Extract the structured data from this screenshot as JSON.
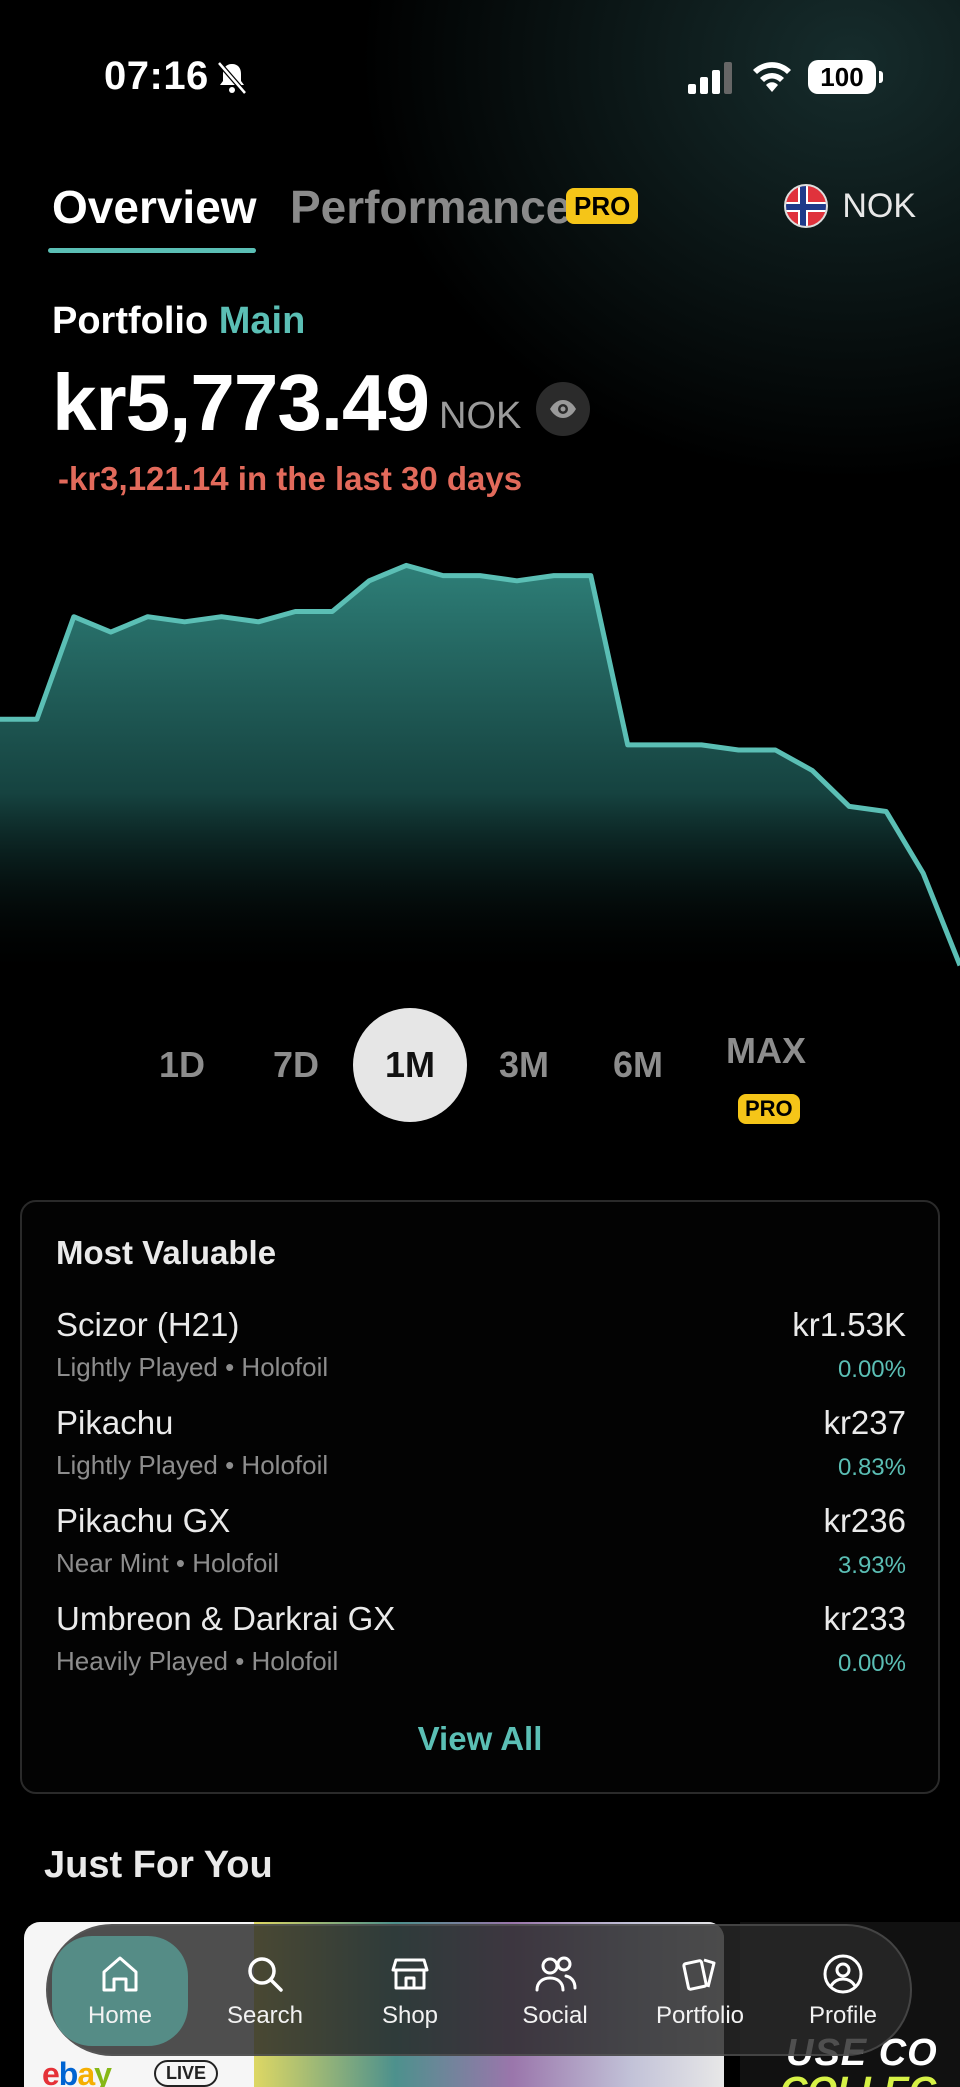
{
  "status_bar": {
    "time": "07:16",
    "battery": "100"
  },
  "tabs": {
    "overview": "Overview",
    "performance": "Performance",
    "performance_badge": "PRO",
    "currency": "NOK"
  },
  "portfolio": {
    "label": "Portfolio",
    "name": "Main",
    "value": "kr5,773.49",
    "value_currency": "NOK",
    "change_text": "-kr3,121.14 in the last 30 days",
    "change_color": "#e26a5b"
  },
  "chart_data": {
    "type": "area",
    "values": [
      5.95,
      5.95,
      6.15,
      6.12,
      6.15,
      6.14,
      6.15,
      6.14,
      6.16,
      6.16,
      6.22,
      6.25,
      6.23,
      6.23,
      6.22,
      6.23,
      6.23,
      5.9,
      5.9,
      5.9,
      5.89,
      5.89,
      5.85,
      5.78,
      5.77,
      5.65,
      5.47
    ],
    "line_color": "#5bbfb5",
    "grid": false
  },
  "ranges": {
    "items": [
      "1D",
      "7D",
      "1M",
      "3M",
      "6M",
      "MAX"
    ],
    "selected": "1M",
    "max_badge": "PRO"
  },
  "most_valuable": {
    "title": "Most Valuable",
    "items": [
      {
        "name": "Scizor (H21)",
        "details": "Lightly Played • Holofoil",
        "price": "kr1.53K",
        "change": "0.00%"
      },
      {
        "name": "Pikachu",
        "details": "Lightly Played • Holofoil",
        "price": "kr237",
        "change": "0.83%"
      },
      {
        "name": "Pikachu GX",
        "details": "Near Mint • Holofoil",
        "price": "kr236",
        "change": "3.93%"
      },
      {
        "name": "Umbreon & Darkrai GX",
        "details": "Heavily Played • Holofoil",
        "price": "kr233",
        "change": "0.00%"
      }
    ],
    "view_all": "View All"
  },
  "just_for_you": {
    "title": "Just For You",
    "banner_live": "LIVE",
    "banner2_line1": "USE CO",
    "banner2_line2": "COLLEC"
  },
  "nav": {
    "items": [
      {
        "label": "Home",
        "icon": "home-icon"
      },
      {
        "label": "Search",
        "icon": "search-icon"
      },
      {
        "label": "Shop",
        "icon": "shop-icon"
      },
      {
        "label": "Social",
        "icon": "social-icon"
      },
      {
        "label": "Portfolio",
        "icon": "cards-icon"
      },
      {
        "label": "Profile",
        "icon": "profile-icon"
      }
    ],
    "active": "Home"
  },
  "colors": {
    "accent": "#5bbfb5",
    "pro": "#f5c518",
    "negative": "#e26a5b"
  }
}
